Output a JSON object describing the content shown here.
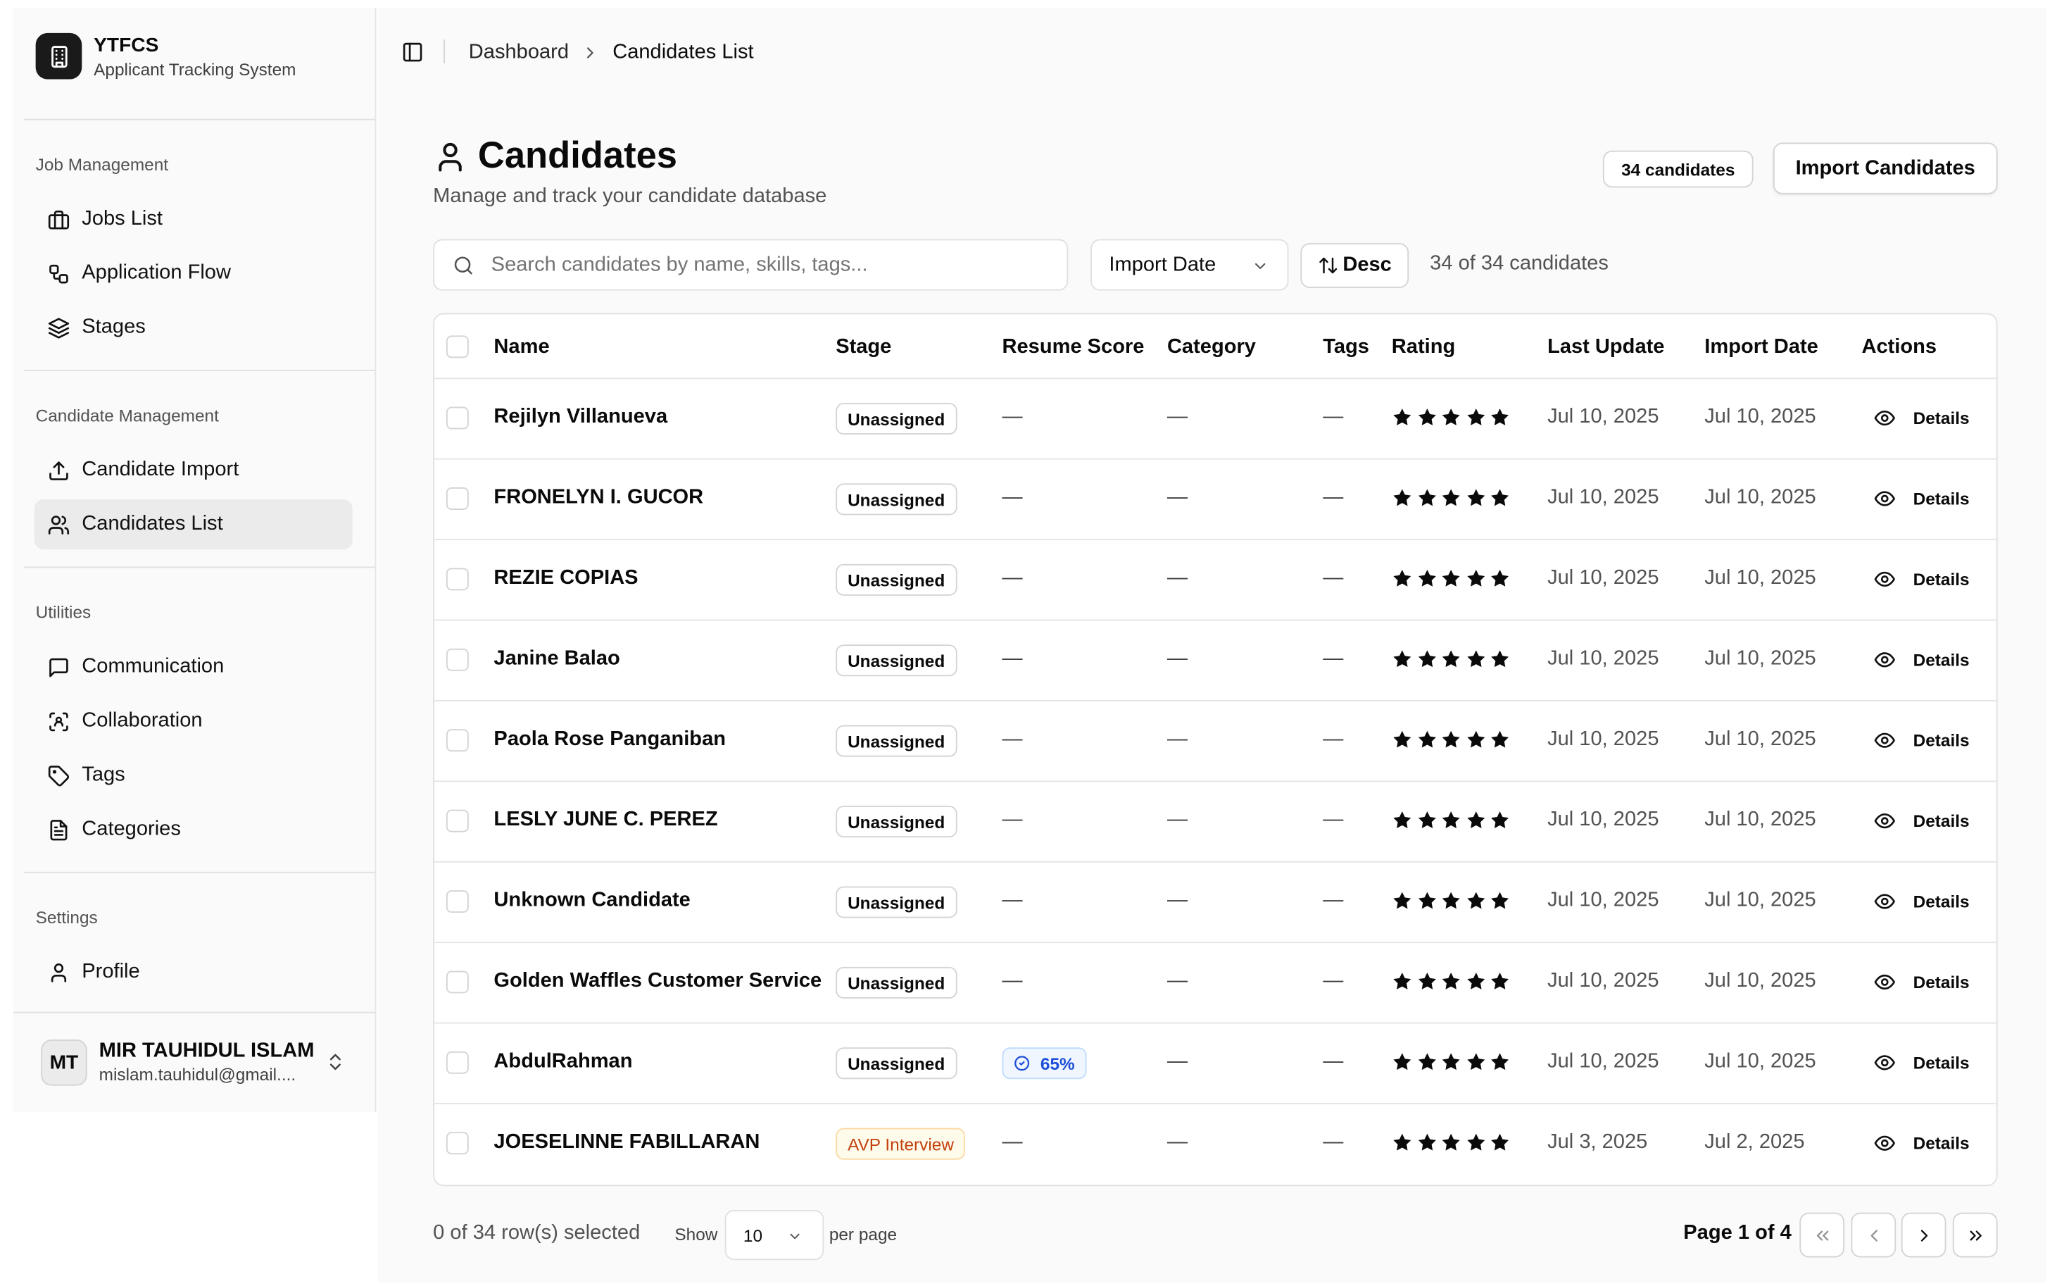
{
  "brand": {
    "title": "YTFCS",
    "subtitle": "Applicant Tracking System",
    "icon": "building-icon"
  },
  "sidebar": {
    "groups": [
      {
        "label": "Job Management",
        "items": [
          {
            "label": "Jobs List",
            "icon": "briefcase-icon"
          },
          {
            "label": "Application Flow",
            "icon": "workflow-icon"
          },
          {
            "label": "Stages",
            "icon": "layers-icon"
          }
        ]
      },
      {
        "label": "Candidate Management",
        "items": [
          {
            "label": "Candidate Import",
            "icon": "upload-icon"
          },
          {
            "label": "Candidates List",
            "icon": "users-icon",
            "active": true
          }
        ]
      },
      {
        "label": "Utilities",
        "items": [
          {
            "label": "Communication",
            "icon": "message-square-icon"
          },
          {
            "label": "Collaboration",
            "icon": "scan-face-icon"
          },
          {
            "label": "Tags",
            "icon": "tag-icon"
          },
          {
            "label": "Categories",
            "icon": "file-text-icon"
          }
        ]
      },
      {
        "label": "Settings",
        "items": [
          {
            "label": "Profile",
            "icon": "user-icon"
          }
        ]
      }
    ]
  },
  "user": {
    "initials": "MT",
    "name": "MIR TAUHIDUL ISLAM",
    "email": "mislam.tauhidul@gmail...."
  },
  "breadcrumb": {
    "parent": "Dashboard",
    "current": "Candidates List"
  },
  "page": {
    "title": "Candidates",
    "subtitle": "Manage and track your candidate database",
    "count_badge": "34 candidates",
    "import_button": "Import Candidates"
  },
  "toolbar": {
    "search_placeholder": "Search candidates by name, skills, tags...",
    "sort_field": "Import Date",
    "sort_order": "Desc",
    "result_count": "34 of 34 candidates"
  },
  "table": {
    "columns": [
      "Name",
      "Stage",
      "Resume Score",
      "Category",
      "Tags",
      "Rating",
      "Last Update",
      "Import Date",
      "Actions"
    ],
    "action_label": "Details",
    "rows": [
      {
        "name": "Rejilyn Villanueva",
        "stage": "Unassigned",
        "score": "—",
        "category": "—",
        "tags": "—",
        "rating": 5,
        "last_update": "Jul 10, 2025",
        "import_date": "Jul 10, 2025"
      },
      {
        "name": "FRONELYN I. GUCOR",
        "stage": "Unassigned",
        "score": "—",
        "category": "—",
        "tags": "—",
        "rating": 5,
        "last_update": "Jul 10, 2025",
        "import_date": "Jul 10, 2025"
      },
      {
        "name": "REZIE COPIAS",
        "stage": "Unassigned",
        "score": "—",
        "category": "—",
        "tags": "—",
        "rating": 5,
        "last_update": "Jul 10, 2025",
        "import_date": "Jul 10, 2025"
      },
      {
        "name": "Janine Balao",
        "stage": "Unassigned",
        "score": "—",
        "category": "—",
        "tags": "—",
        "rating": 5,
        "last_update": "Jul 10, 2025",
        "import_date": "Jul 10, 2025"
      },
      {
        "name": "Paola Rose Panganiban",
        "stage": "Unassigned",
        "score": "—",
        "category": "—",
        "tags": "—",
        "rating": 5,
        "last_update": "Jul 10, 2025",
        "import_date": "Jul 10, 2025"
      },
      {
        "name": "LESLY JUNE C. PEREZ",
        "stage": "Unassigned",
        "score": "—",
        "category": "—",
        "tags": "—",
        "rating": 5,
        "last_update": "Jul 10, 2025",
        "import_date": "Jul 10, 2025"
      },
      {
        "name": "Unknown Candidate",
        "stage": "Unassigned",
        "score": "—",
        "category": "—",
        "tags": "—",
        "rating": 5,
        "last_update": "Jul 10, 2025",
        "import_date": "Jul 10, 2025"
      },
      {
        "name": "Golden Waffles Customer Service",
        "stage": "Unassigned",
        "score": "—",
        "category": "—",
        "tags": "—",
        "rating": 5,
        "last_update": "Jul 10, 2025",
        "import_date": "Jul 10, 2025"
      },
      {
        "name": "AbdulRahman",
        "stage": "Unassigned",
        "score": "65%",
        "category": "—",
        "tags": "—",
        "rating": 5,
        "last_update": "Jul 10, 2025",
        "import_date": "Jul 10, 2025"
      },
      {
        "name": "JOESELINNE FABILLARAN",
        "stage": "AVP Interview",
        "score": "—",
        "category": "—",
        "tags": "—",
        "rating": 5,
        "last_update": "Jul 3, 2025",
        "import_date": "Jul 2, 2025"
      }
    ]
  },
  "footer": {
    "selected": "0 of 34 row(s) selected",
    "show_label": "Show",
    "per_page_value": "10",
    "per_page_label": "per page",
    "page_info": "Page 1 of 4"
  },
  "colors": {
    "stage_default": "#d4d4d4",
    "stage_avp": "#c2410c",
    "score": "#1d4ed8",
    "star": "#0a0a0a"
  }
}
